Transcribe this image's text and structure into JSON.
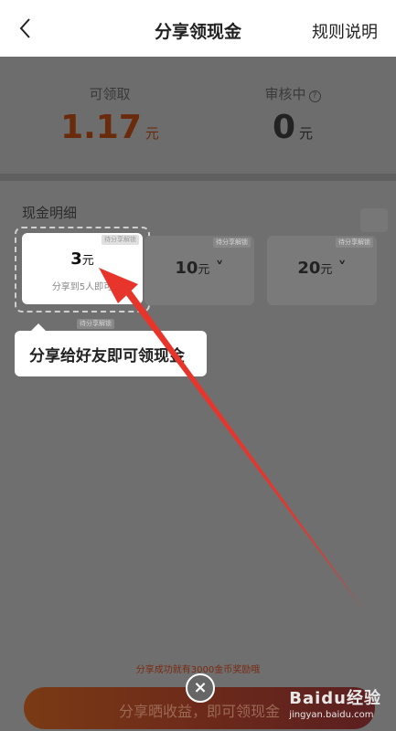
{
  "nav": {
    "title": "分享领现金",
    "rules": "规则说明"
  },
  "stats": {
    "claimable_label": "可领取",
    "claimable_value": "1.17",
    "unit": "元",
    "reviewing_label": "审核中",
    "reviewing_value": "0",
    "help_glyph": "?"
  },
  "details": {
    "title": "现金明细",
    "cards": [
      {
        "amount": "3",
        "unit": "元",
        "subtitle": "分享到5人即可",
        "tag": "待分享解锁"
      },
      {
        "amount": "10",
        "unit": "元",
        "tag": "待分享解锁"
      },
      {
        "amount": "20",
        "unit": "元",
        "tag": "待分享解锁"
      }
    ],
    "more_tag": "待分享解锁"
  },
  "tooltip": {
    "text": "分享给好友即可领现金"
  },
  "footer": {
    "bonus_text": "分享成功就有3000金币奖励哦",
    "cta_label": "分享晒收益，即可领现金",
    "close_glyph": "×"
  },
  "watermark": {
    "main": "Baidu经验",
    "sub": "jingyan.baidu.com"
  },
  "colors": {
    "arrow": "#e8352c",
    "accent": "#6a2b0d",
    "cta": "#7a3a14"
  },
  "icons": {
    "back": "chevron-left-icon",
    "help": "question-circle-icon",
    "lock": "lock-icon",
    "close": "close-icon",
    "dropdown": "chevron-down-icon"
  }
}
